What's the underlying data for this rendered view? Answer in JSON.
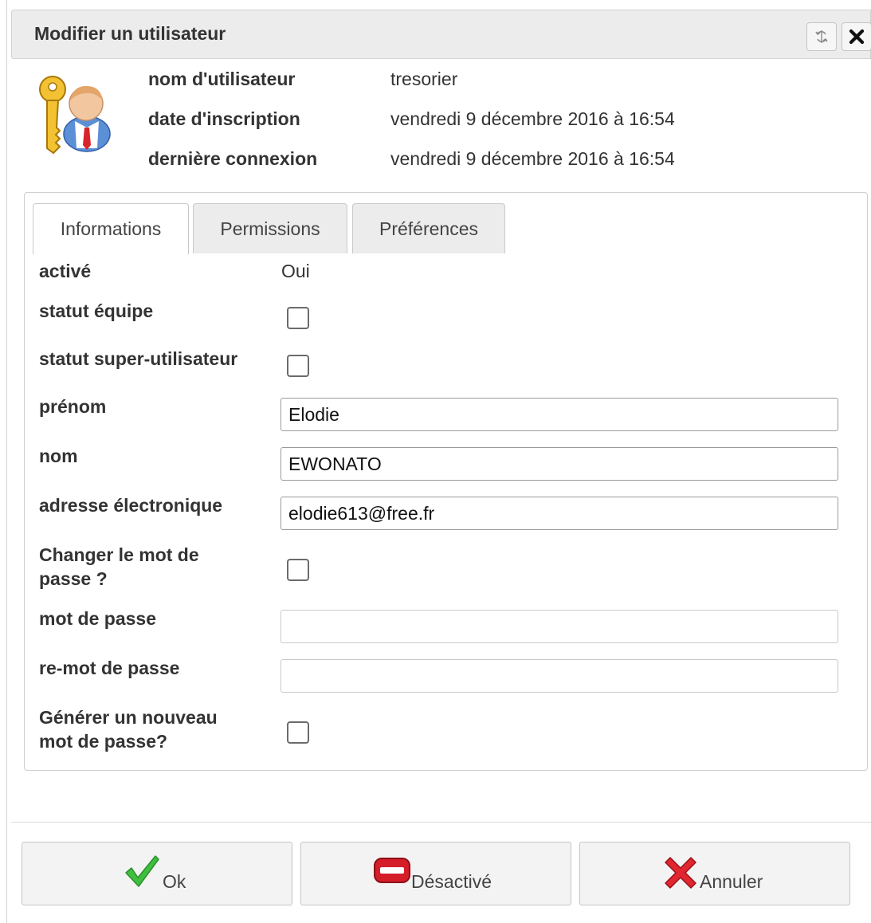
{
  "dialog": {
    "title": "Modifier un utilisateur"
  },
  "user_info": {
    "username_label": "nom d'utilisateur",
    "username_value": "tresorier",
    "registration_label": "date d'inscription",
    "registration_value": "vendredi 9 décembre 2016 à 16:54",
    "last_login_label": "dernière connexion",
    "last_login_value": "vendredi 9 décembre 2016 à 16:54"
  },
  "tabs": [
    {
      "label": "Informations",
      "active": true
    },
    {
      "label": "Permissions",
      "active": false
    },
    {
      "label": "Préférences",
      "active": false
    }
  ],
  "form": {
    "active_label": "activé",
    "active_value": "Oui",
    "team_status_label": "statut équipe",
    "superuser_label": "statut super-utilisateur",
    "firstname_label": "prénom",
    "firstname_value": "Elodie",
    "lastname_label": "nom",
    "lastname_value": "EWONATO",
    "email_label": "adresse électronique",
    "email_value": "elodie613@free.fr",
    "change_password_label": "Changer le mot de passe ?",
    "password_label": "mot de passe",
    "password_value": "",
    "repassword_label": "re-mot de passe",
    "repassword_value": "",
    "generate_password_label": "Générer un nouveau mot de passe?"
  },
  "buttons": {
    "ok": "Ok",
    "deactivate": "Désactivé",
    "cancel": "Annuler"
  },
  "icons": {
    "refresh": "refresh-icon",
    "close": "close-icon",
    "user_key": "user-key-icon",
    "ok": "checkmark-icon",
    "deactivate": "minus-icon",
    "cancel": "cross-icon"
  },
  "colors": {
    "ok_icon": "#3fbf3f",
    "deactivate_icon": "#d41e2a",
    "cancel_icon": "#e0262f",
    "titlebar": "#ececec"
  }
}
